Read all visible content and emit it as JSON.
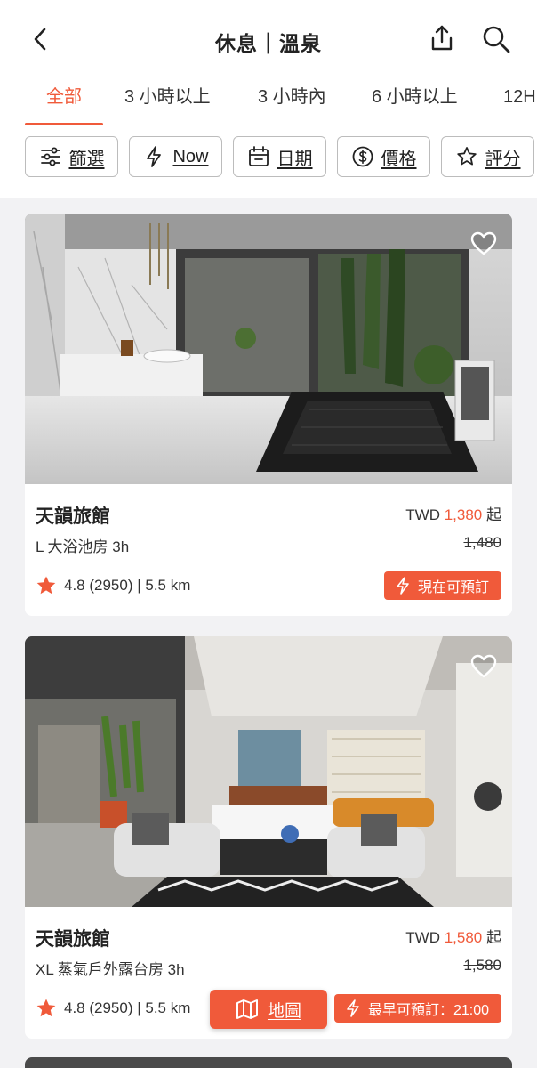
{
  "header": {
    "title": "休息｜溫泉",
    "back_icon": "chevron-left-icon",
    "share_icon": "share-icon",
    "search_icon": "search-icon"
  },
  "tabs": [
    {
      "label": "全部",
      "active": true
    },
    {
      "label": "3 小時以上",
      "active": false
    },
    {
      "label": "3 小時內",
      "active": false
    },
    {
      "label": "6 小時以上",
      "active": false
    },
    {
      "label": "12H",
      "active": false
    }
  ],
  "filters": [
    {
      "label": "篩選",
      "icon": "sliders-icon"
    },
    {
      "label": "Now",
      "icon": "lightning-icon"
    },
    {
      "label": "日期",
      "icon": "calendar-icon"
    },
    {
      "label": "價格",
      "icon": "dollar-icon"
    },
    {
      "label": "評分",
      "icon": "star-outline-icon"
    }
  ],
  "listings": [
    {
      "name": "天韻旅館",
      "currency": "TWD",
      "price": "1,380",
      "price_suffix": "起",
      "room": "L 大浴池房 3h",
      "original_price": "1,480",
      "rating": "4.8 (2950) | 5.5 km",
      "badge": "現在可預訂"
    },
    {
      "name": "天韻旅館",
      "currency": "TWD",
      "price": "1,580",
      "price_suffix": "起",
      "room": "XL 蒸氣戶外露台房 3h",
      "original_price": "1,580",
      "rating": "4.8 (2950) | 5.5 km",
      "badge": "最早可預訂：21:00"
    }
  ],
  "map_button": {
    "label": "地圖",
    "icon": "map-icon"
  },
  "colors": {
    "accent": "#f05a3a"
  }
}
